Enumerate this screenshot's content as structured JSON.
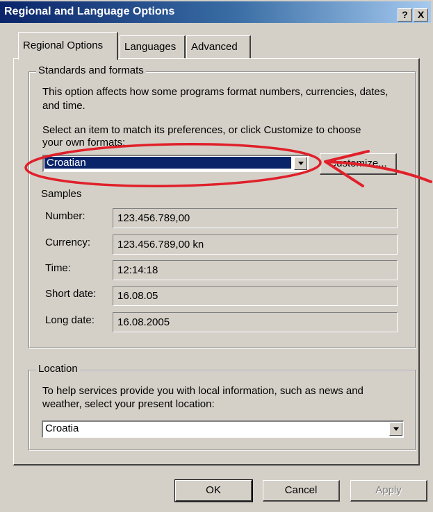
{
  "window": {
    "title": "Regional and Language Options",
    "help_label": "?",
    "close_label": "X"
  },
  "tabs": [
    {
      "label": "Regional Options",
      "active": true
    },
    {
      "label": "Languages",
      "active": false
    },
    {
      "label": "Advanced",
      "active": false
    }
  ],
  "standards": {
    "group_label": "Standards and formats",
    "description": "This option affects how some programs format numbers, currencies, dates, and time.",
    "select_prompt_line1": "Select an item to match its preferences, or click Customize to choose",
    "select_prompt_line2": "your own formats:",
    "selected_format": "Croatian",
    "customize_label": "Customize..."
  },
  "samples": {
    "group_label": "Samples",
    "rows": [
      {
        "label": "Number:",
        "value": "123.456.789,00"
      },
      {
        "label": "Currency:",
        "value": "123.456.789,00 kn"
      },
      {
        "label": "Time:",
        "value": "12:14:18"
      },
      {
        "label": "Short date:",
        "value": "16.08.05"
      },
      {
        "label": "Long date:",
        "value": "16.08.2005"
      }
    ]
  },
  "location": {
    "group_label": "Location",
    "description_line1": "To help services provide you with local information, such as news and",
    "description_line2": "weather, select your present location:",
    "selected_location": "Croatia"
  },
  "buttons": {
    "ok": "OK",
    "cancel": "Cancel",
    "apply": "Apply"
  },
  "annotation": {
    "color": "#e0202a"
  }
}
